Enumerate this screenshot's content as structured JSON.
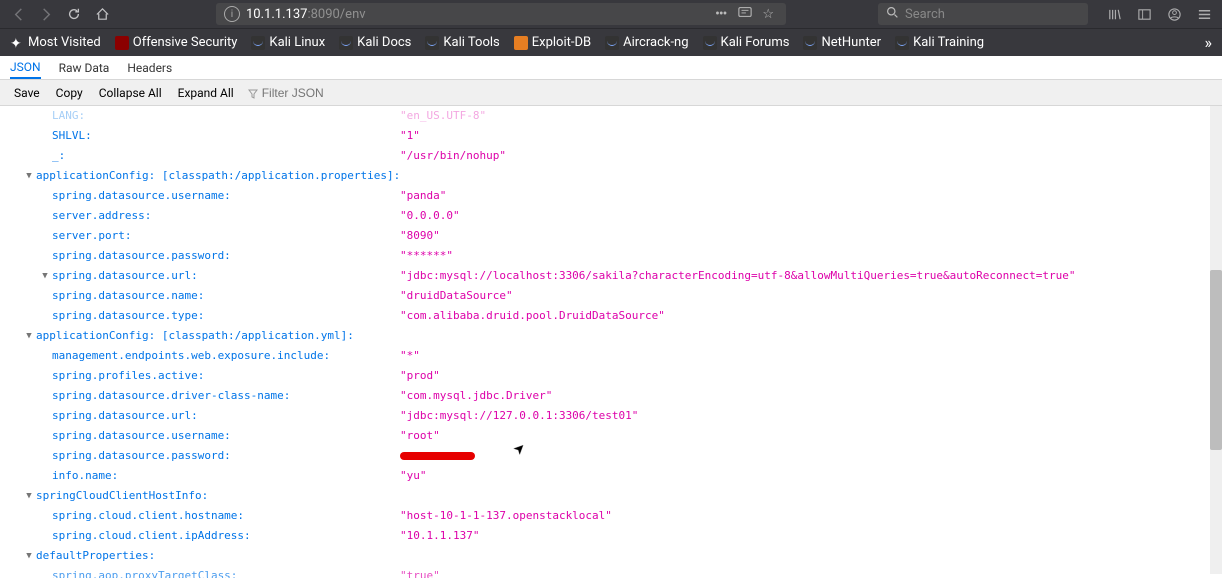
{
  "navbar": {
    "url_host": "10.1.1.137",
    "url_rest": ":8090/env",
    "search_placeholder": "Search"
  },
  "bookmarks": [
    {
      "label": "Most Visited"
    },
    {
      "label": "Offensive Security"
    },
    {
      "label": "Kali Linux"
    },
    {
      "label": "Kali Docs"
    },
    {
      "label": "Kali Tools"
    },
    {
      "label": "Exploit-DB"
    },
    {
      "label": "Aircrack-ng"
    },
    {
      "label": "Kali Forums"
    },
    {
      "label": "NetHunter"
    },
    {
      "label": "Kali Training"
    }
  ],
  "tabs": {
    "json": "JSON",
    "raw": "Raw Data",
    "headers": "Headers"
  },
  "toolbar": {
    "save": "Save",
    "copy": "Copy",
    "collapse": "Collapse All",
    "expand": "Expand All",
    "filter_placeholder": "Filter JSON"
  },
  "json": {
    "top": [
      {
        "indent": 2,
        "key": "LANG:",
        "val": "\"en_US.UTF-8\"",
        "faded": true
      },
      {
        "indent": 2,
        "key": "SHLVL:",
        "val": "\"1\""
      },
      {
        "indent": 2,
        "key": "_:",
        "val": "\"/usr/bin/nohup\""
      }
    ],
    "appProps": {
      "header_key": "applicationConfig: [classpath:/application.properties]:",
      "items": [
        {
          "key": "spring.datasource.username:",
          "val": "\"panda\""
        },
        {
          "key": "server.address:",
          "val": "\"0.0.0.0\""
        },
        {
          "key": "server.port:",
          "val": "\"8090\""
        },
        {
          "key": "spring.datasource.password:",
          "val": "\"******\""
        },
        {
          "key": "spring.datasource.url:",
          "val": "\"jdbc:mysql://localhost:3306/sakila?characterEncoding=utf-8&allowMultiQueries=true&autoReconnect=true\"",
          "toggle": true
        },
        {
          "key": "spring.datasource.name:",
          "val": "\"druidDataSource\""
        },
        {
          "key": "spring.datasource.type:",
          "val": "\"com.alibaba.druid.pool.DruidDataSource\""
        }
      ]
    },
    "appYml": {
      "header_key": "applicationConfig: [classpath:/application.yml]:",
      "items": [
        {
          "key": "management.endpoints.web.exposure.include:",
          "val": "\"*\""
        },
        {
          "key": "spring.profiles.active:",
          "val": "\"prod\""
        },
        {
          "key": "spring.datasource.driver-class-name:",
          "val": "\"com.mysql.jdbc.Driver\""
        },
        {
          "key": "spring.datasource.url:",
          "val": "\"jdbc:mysql://127.0.0.1:3306/test01\""
        },
        {
          "key": "spring.datasource.username:",
          "val": "\"root\""
        },
        {
          "key": "spring.datasource.password:",
          "val": "REDACTED"
        },
        {
          "key": "info.name:",
          "val": "\"yu\""
        }
      ]
    },
    "hostInfo": {
      "header_key": "springCloudClientHostInfo:",
      "items": [
        {
          "key": "spring.cloud.client.hostname:",
          "val": "\"host-10-1-1-137.openstacklocal\""
        },
        {
          "key": "spring.cloud.client.ipAddress:",
          "val": "\"10.1.1.137\""
        }
      ]
    },
    "defaultProps": {
      "header_key": "defaultProperties:",
      "items": [
        {
          "key": "spring.aop.proxyTargetClass:",
          "val": "\"true\""
        }
      ]
    }
  }
}
